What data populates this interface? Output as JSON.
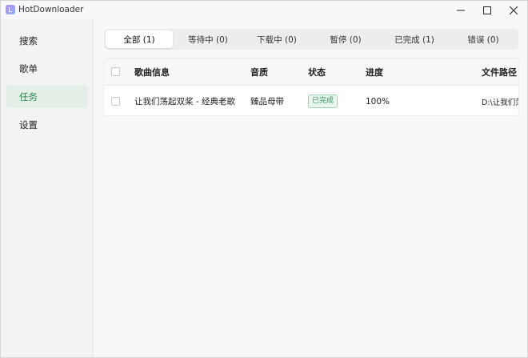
{
  "app": {
    "title": "HotDownloader",
    "icon": "music-note-icon"
  },
  "sidebar": {
    "items": [
      {
        "label": "搜索",
        "active": false
      },
      {
        "label": "歌单",
        "active": false
      },
      {
        "label": "任务",
        "active": true
      },
      {
        "label": "设置",
        "active": false
      }
    ]
  },
  "tabs": [
    {
      "label": "全部 (1)",
      "active": true
    },
    {
      "label": "等待中 (0)",
      "active": false
    },
    {
      "label": "下载中 (0)",
      "active": false
    },
    {
      "label": "暂停 (0)",
      "active": false
    },
    {
      "label": "已完成 (1)",
      "active": false
    },
    {
      "label": "错误 (0)",
      "active": false
    }
  ],
  "table": {
    "columns": [
      "歌曲信息",
      "音质",
      "状态",
      "进度",
      "文件路径"
    ],
    "rows": [
      {
        "song": "让我们荡起双桨 - 经典老歌",
        "quality": "臻品母带",
        "status": "已完成",
        "progress": "100%",
        "path": "D:\\让我们荡"
      }
    ]
  },
  "colors": {
    "accent": "#2f8a4d",
    "active_nav_bg": "#e4efe8",
    "status_done": "#2f9a55"
  }
}
